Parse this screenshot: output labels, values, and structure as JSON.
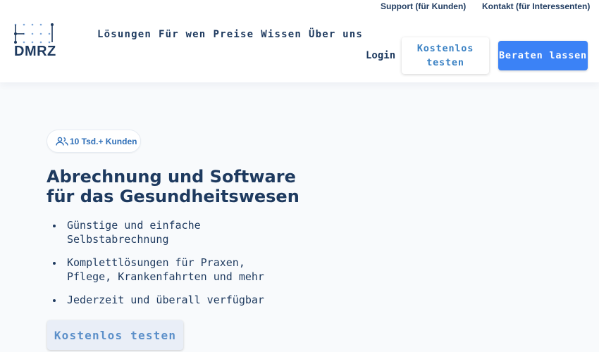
{
  "top_links": {
    "support": "Support (für Kunden)",
    "contact": "Kontakt (für Interessenten)"
  },
  "logo": {
    "text": "DMRZ"
  },
  "nav": {
    "items": [
      {
        "label": "Lösungen"
      },
      {
        "label": "Für wen"
      },
      {
        "label": "Preise"
      },
      {
        "label": "Wissen"
      },
      {
        "label": "Über uns"
      }
    ]
  },
  "header_actions": {
    "login": "Login",
    "trial": "Kostenlos testen",
    "consult": "Beraten lassen"
  },
  "hero": {
    "badge": {
      "text": "10 Tsd.+ Kunden",
      "icon": "users-icon"
    },
    "headline": "Abrechnung und Software für das Gesundheitswesen",
    "bullets": [
      "Günstige und einfache Selbstabrechnung",
      "Komplettlösungen für Praxen, Pflege, Krankenfahrten und mehr",
      "Jederzeit und überall verfügbar"
    ],
    "cta": "Kostenlos testen"
  },
  "colors": {
    "navy": "#1e3a5f",
    "primary_blue": "#3b82f6",
    "link_blue": "#3b82c4",
    "background": "#f8fafc"
  }
}
